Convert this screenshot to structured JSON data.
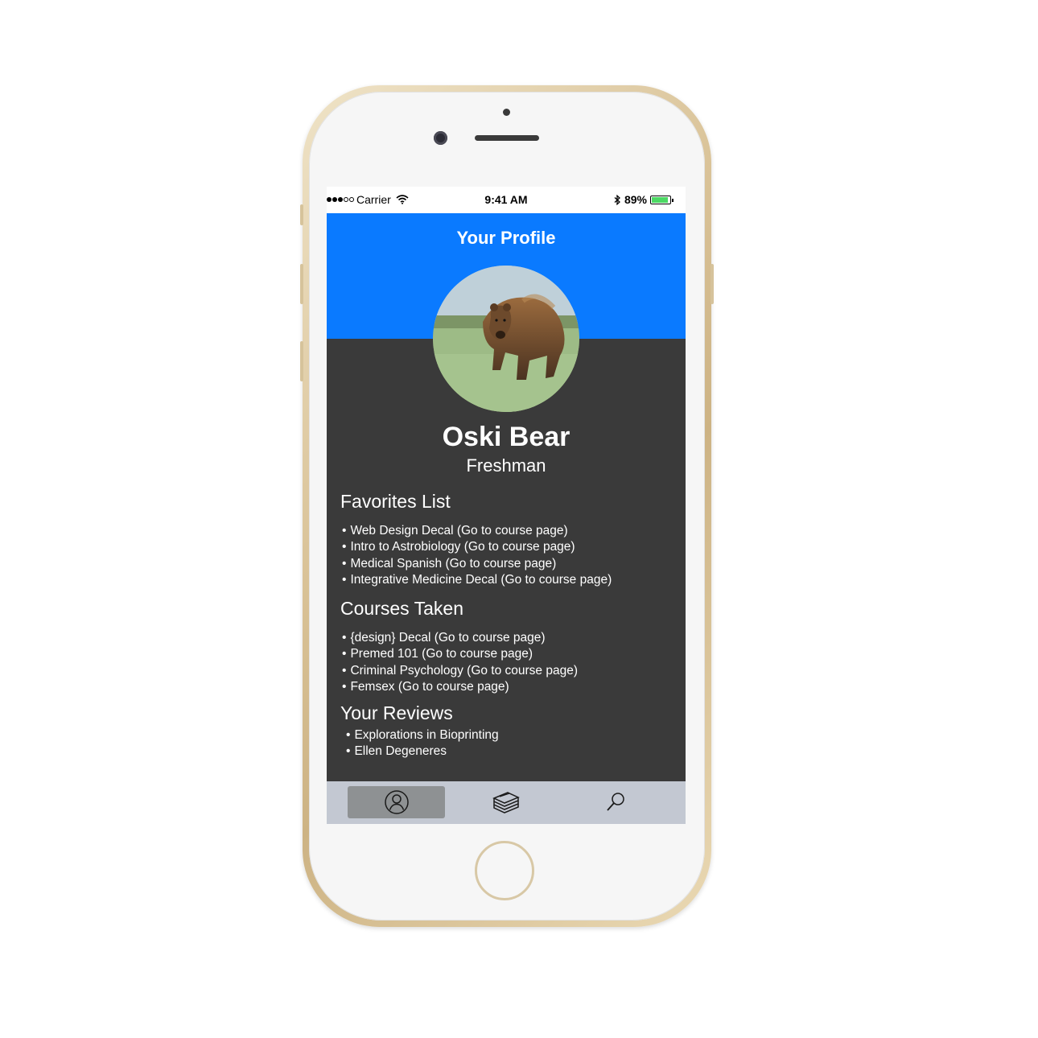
{
  "status_bar": {
    "carrier": "Carrier",
    "time": "9:41 AM",
    "battery": "89%",
    "battery_level": 0.89
  },
  "header": {
    "title": "Your Profile"
  },
  "profile": {
    "name": "Oski Bear",
    "year": "Freshman"
  },
  "favorites": {
    "title": "Favorites List",
    "items": [
      "Web Design Decal (Go to course page)",
      "Intro to Astrobiology (Go to course page)",
      "Medical Spanish (Go to course page)",
      "Integrative Medicine Decal (Go to course page)"
    ]
  },
  "courses_taken": {
    "title": "Courses Taken",
    "items": [
      "{design} Decal (Go to course page)",
      "Premed 101 (Go to course page)",
      "Criminal Psychology (Go to course page)",
      "Femsex (Go to course page)"
    ]
  },
  "reviews": {
    "title": "Your Reviews",
    "items": [
      "Explorations in Bioprinting",
      "Ellen Degeneres"
    ]
  },
  "tab_bar": {
    "tabs": [
      {
        "icon": "profile-icon",
        "active": true
      },
      {
        "icon": "books-icon",
        "active": false
      },
      {
        "icon": "search-icon",
        "active": false
      }
    ]
  },
  "colors": {
    "header_blue": "#0a7aff",
    "body_dark": "#3a3a3a",
    "tab_bar": "#c3c8d2",
    "tab_active": "#8e9193"
  }
}
